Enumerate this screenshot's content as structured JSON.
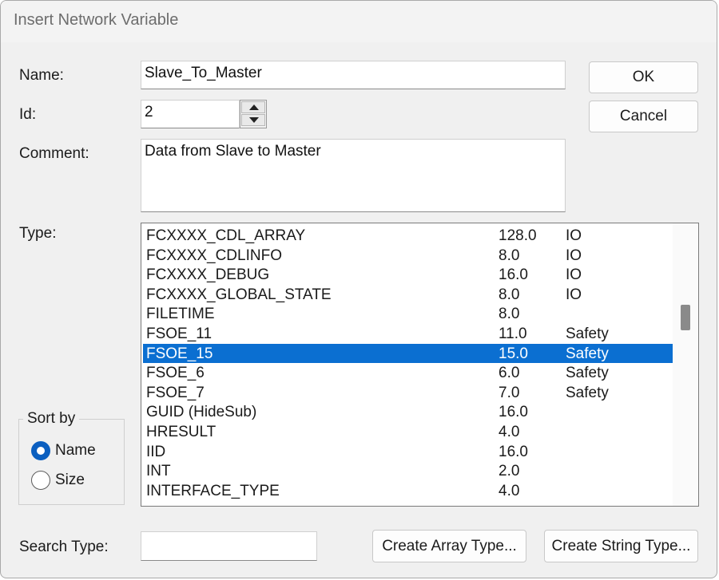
{
  "window": {
    "title": "Insert Network Variable"
  },
  "form": {
    "name_label": "Name:",
    "name_value": "Slave_To_Master",
    "id_label": "Id:",
    "id_value": "2",
    "comment_label": "Comment:",
    "comment_value": "Data from Slave to Master",
    "type_label": "Type:",
    "search_label": "Search Type:",
    "search_value": ""
  },
  "buttons": {
    "ok": "OK",
    "cancel": "Cancel",
    "create_array": "Create Array Type...",
    "create_string": "Create String Type..."
  },
  "sort": {
    "title": "Sort by",
    "name_option": "Name",
    "size_option": "Size",
    "selected": "Name"
  },
  "type_list": {
    "selected_index": 6,
    "rows": [
      {
        "name": "FCXXXX_CDL_ARRAY",
        "size": "128.0",
        "category": "IO"
      },
      {
        "name": "FCXXXX_CDLINFO",
        "size": "8.0",
        "category": "IO"
      },
      {
        "name": "FCXXXX_DEBUG",
        "size": "16.0",
        "category": "IO"
      },
      {
        "name": "FCXXXX_GLOBAL_STATE",
        "size": "8.0",
        "category": "IO"
      },
      {
        "name": "FILETIME",
        "size": "8.0",
        "category": ""
      },
      {
        "name": "FSOE_11",
        "size": "11.0",
        "category": "Safety"
      },
      {
        "name": "FSOE_15",
        "size": "15.0",
        "category": "Safety"
      },
      {
        "name": "FSOE_6",
        "size": "6.0",
        "category": "Safety"
      },
      {
        "name": "FSOE_7",
        "size": "7.0",
        "category": "Safety"
      },
      {
        "name": "GUID (HideSub)",
        "size": "16.0",
        "category": ""
      },
      {
        "name": "HRESULT",
        "size": "4.0",
        "category": ""
      },
      {
        "name": "IID",
        "size": "16.0",
        "category": ""
      },
      {
        "name": "INT",
        "size": "2.0",
        "category": ""
      },
      {
        "name": "INTERFACE_TYPE",
        "size": "4.0",
        "category": ""
      }
    ]
  },
  "colors": {
    "selection": "#0b6fd1",
    "radio_checked": "#0b5fc0"
  }
}
